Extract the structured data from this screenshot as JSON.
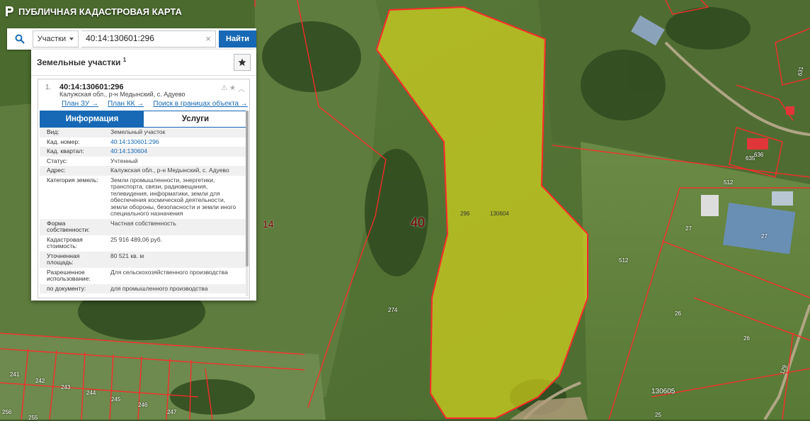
{
  "app": {
    "title": "ПУБЛИЧНАЯ КАДАСТРОВАЯ КАРТА"
  },
  "search": {
    "type_label": "Участки",
    "value": "40:14:130601:296",
    "button_label": "Найти"
  },
  "panel": {
    "title": "Земельные участки",
    "count": "1",
    "result": {
      "index": "1.",
      "cadastral_number": "40:14:130601:296",
      "address": "Калужская обл., р-н Медынский, с. Адуево",
      "links": [
        "План ЗУ →",
        "План КК →",
        "Поиск в границах объекта →"
      ],
      "tabs": [
        "Информация",
        "Услуги"
      ],
      "rows": [
        {
          "k": "Вид:",
          "v": "Земельный участок"
        },
        {
          "k": "Кад. номер:",
          "v": "40:14:130601:296",
          "link": true
        },
        {
          "k": "Кад. квартал:",
          "v": "40:14:130604",
          "link": true
        },
        {
          "k": "Статус:",
          "v": "Учтенный"
        },
        {
          "k": "Адрес:",
          "v": "Калужская обл., р-н Медынский, с. Адуево"
        },
        {
          "k": "Категория земель:",
          "v": "Земли промышленности, энергетики, транспорта, связи, радиовещания, телевидения, информатики, земли для обеспечения космической деятельности, земли обороны, безопасности и земли иного специального назначения"
        },
        {
          "k": "Форма собственности:",
          "v": "Частная собственность"
        },
        {
          "k": "Кадастровая стоимость:",
          "v": "25 916 489,06 руб."
        },
        {
          "k": "Уточненная площадь:",
          "v": "80 521 кв. м"
        },
        {
          "k": "Разрешенное использование:",
          "v": "Для сельскохозяйственного производства"
        },
        {
          "k": "по документу:",
          "v": "для промышленного производства"
        }
      ]
    }
  },
  "map": {
    "highlight_color": "#e6e21a",
    "boundary_color": "#ff2a2a",
    "labels": {
      "quarter_14": "14",
      "quarter_40": "40",
      "parcel_296": "296",
      "parcel_130604": "130604",
      "parcel_274": "274",
      "parcel_512a": "512",
      "parcel_512b": "512",
      "parcel_27": "27",
      "parcel_26a": "26",
      "parcel_26b": "26",
      "parcel_130605": "130605",
      "parcel_25": "25",
      "parcel_129": "129",
      "parcel_636": "636",
      "parcel_635": "635",
      "parcel_631": "631",
      "parcel_241": "241",
      "parcel_242": "242",
      "parcel_243": "243",
      "parcel_244": "244",
      "parcel_245": "245",
      "parcel_246": "246",
      "parcel_247": "247",
      "parcel_256": "256",
      "parcel_255": "255"
    }
  }
}
